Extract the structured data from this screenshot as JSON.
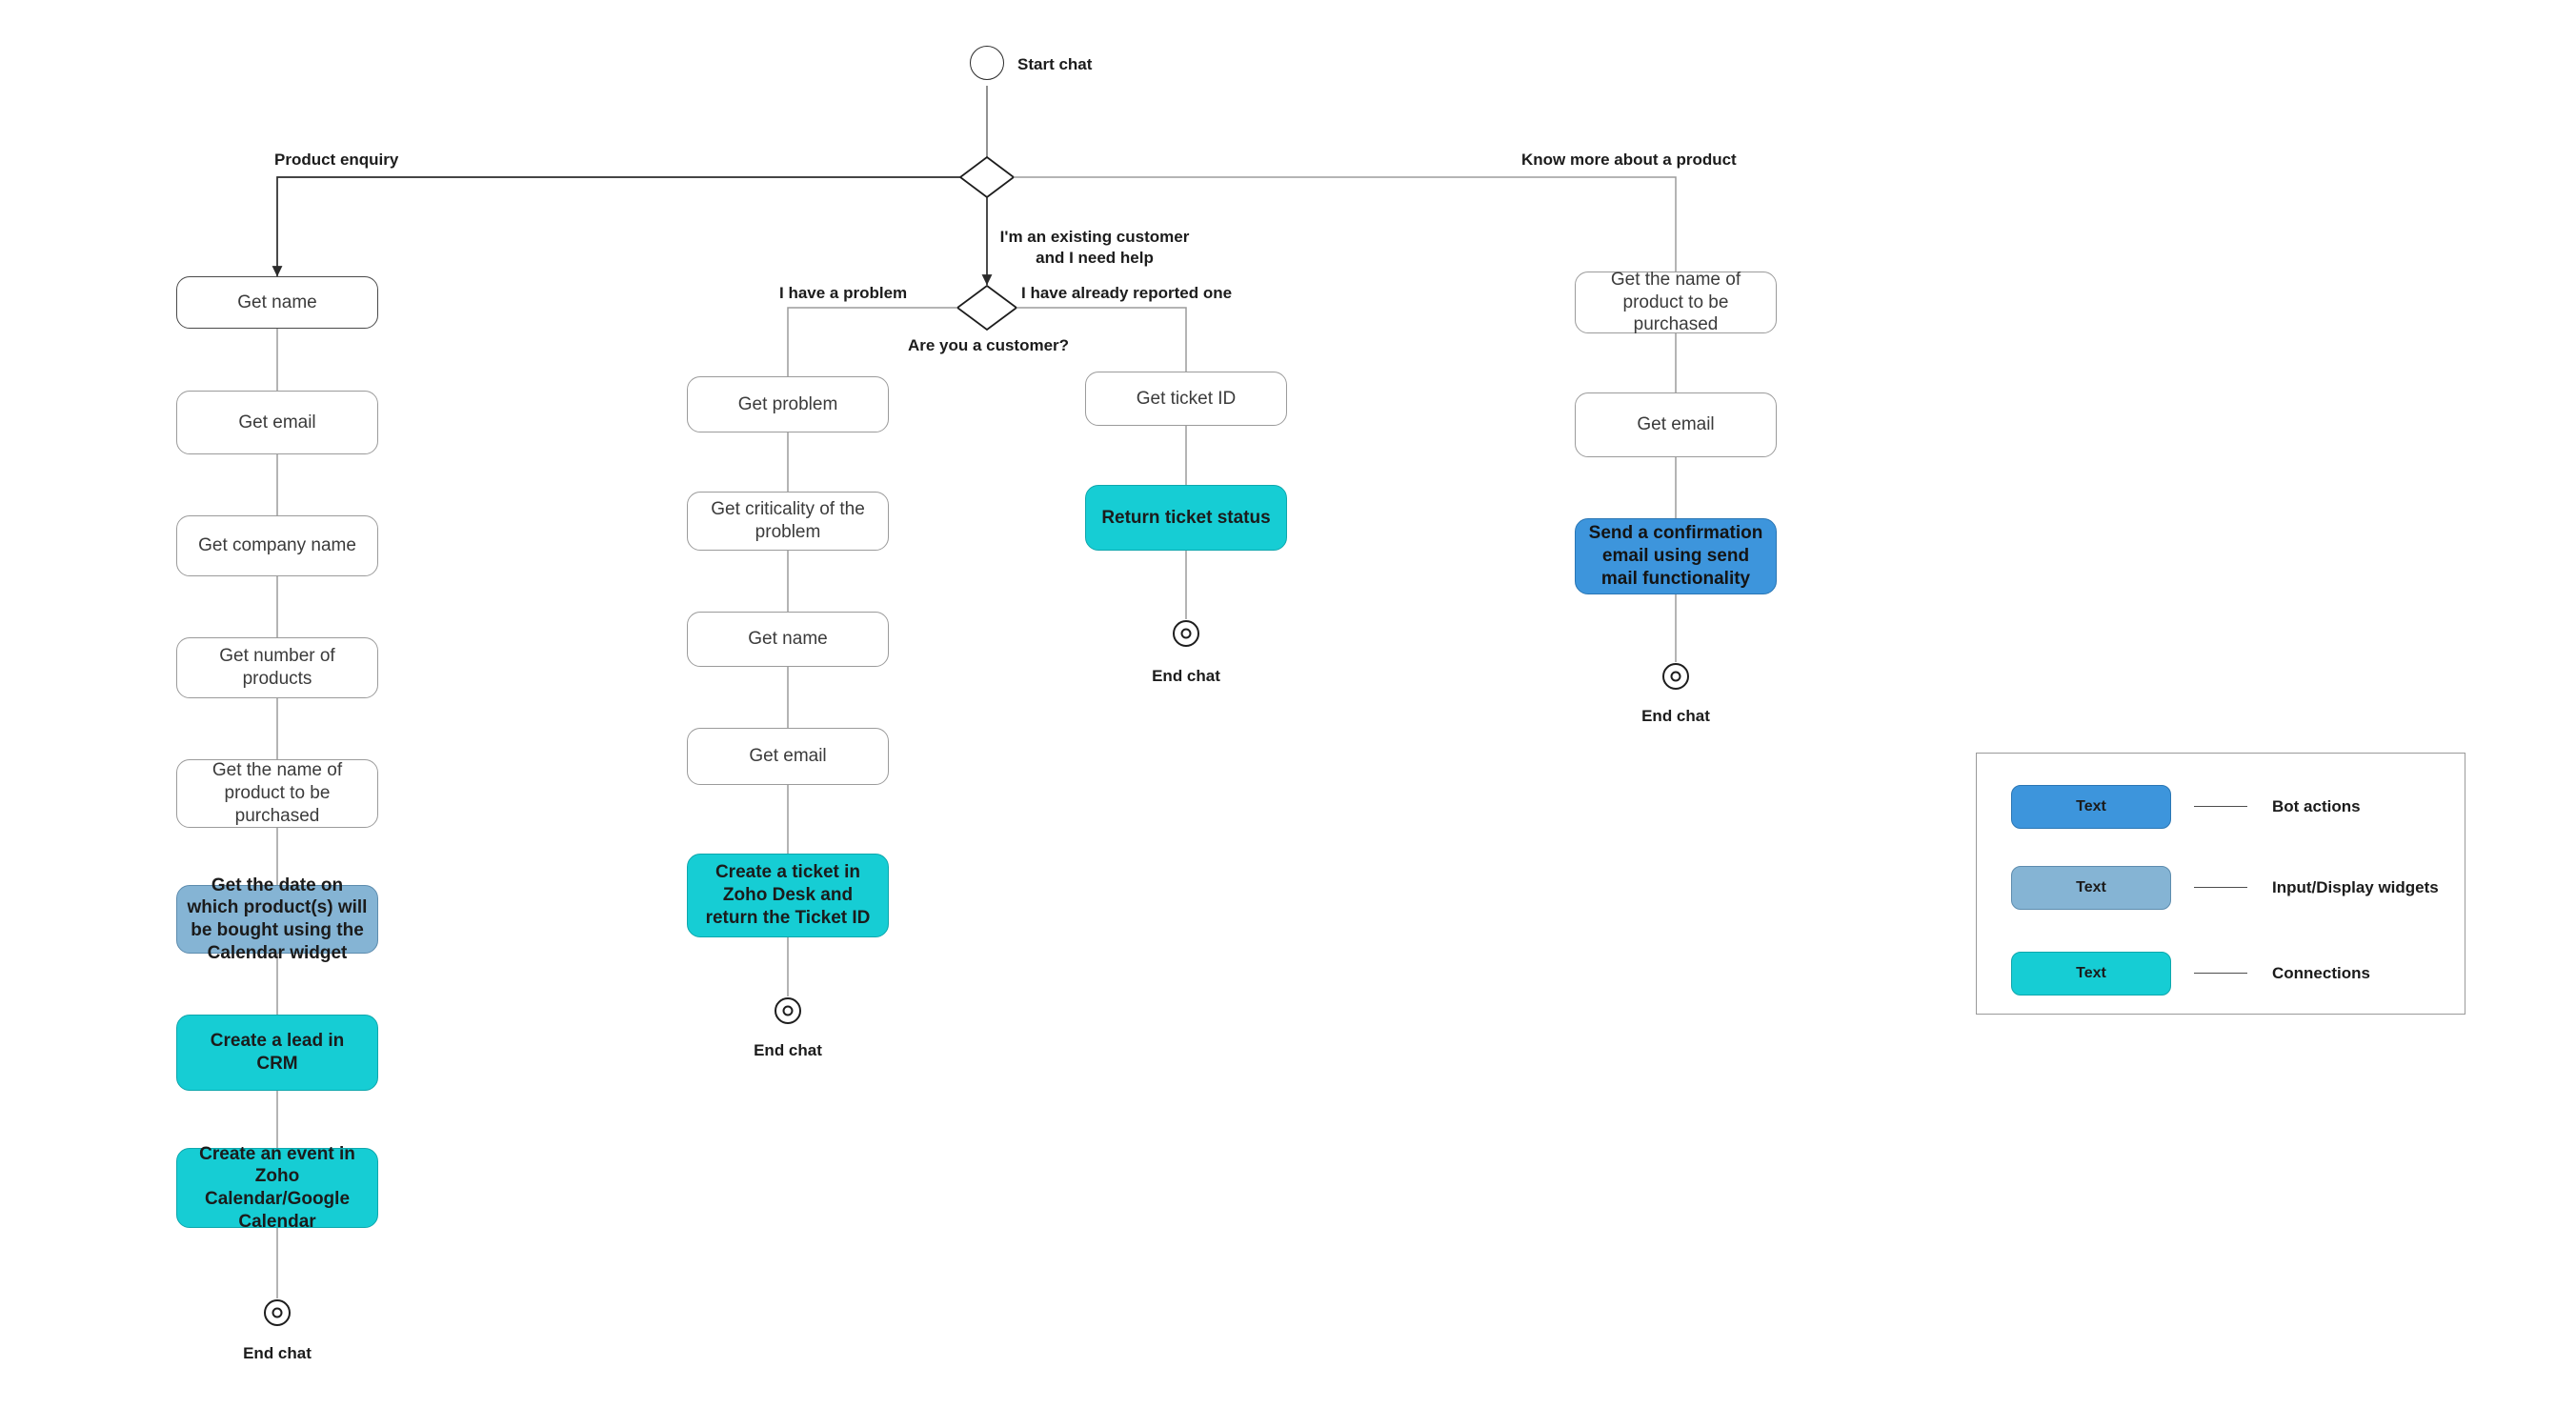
{
  "diagram": {
    "title_present": false,
    "start": {
      "label": "Start chat"
    },
    "decisions": {
      "d1_label": "",
      "d2_label": "Are you a customer?"
    },
    "edge_labels": {
      "product_enquiry": "Product enquiry",
      "existing_customer": "I'm an existing customer and I need help",
      "know_more": "Know more about a product",
      "have_problem": "I have a problem",
      "already_reported": "I have already reported one"
    },
    "branch_left": {
      "nodes": [
        {
          "label": "Get name",
          "kind": "input"
        },
        {
          "label": "Get email",
          "kind": "input"
        },
        {
          "label": "Get  company name",
          "kind": "input"
        },
        {
          "label": "Get  number of products",
          "kind": "input"
        },
        {
          "label": "Get  the name of product to be purchased",
          "kind": "input"
        },
        {
          "label": "Get the date on which product(s) will be bought using the Calendar widget",
          "kind": "widget"
        },
        {
          "label": "Create a lead in CRM",
          "kind": "action"
        },
        {
          "label": "Create an event in Zoho Calendar/Google Calendar",
          "kind": "action"
        }
      ],
      "end_label": "End chat"
    },
    "branch_problem": {
      "nodes": [
        {
          "label": "Get problem",
          "kind": "input"
        },
        {
          "label": "Get  criticality of the problem",
          "kind": "input"
        },
        {
          "label": "Get name",
          "kind": "input"
        },
        {
          "label": "Get email",
          "kind": "input"
        },
        {
          "label": "Create a ticket in Zoho Desk and return the Ticket ID",
          "kind": "action"
        }
      ],
      "end_label": "End chat"
    },
    "branch_ticket": {
      "nodes": [
        {
          "label": "Get ticket ID",
          "kind": "input"
        },
        {
          "label": "Return ticket status",
          "kind": "action"
        }
      ],
      "end_label": "End chat"
    },
    "branch_right": {
      "nodes": [
        {
          "label": "Get  the name of product to be purchased",
          "kind": "input"
        },
        {
          "label": "Get email",
          "kind": "input"
        },
        {
          "label": "Send a confirmation email using send mail functionality",
          "kind": "bot"
        }
      ],
      "end_label": "End chat"
    }
  },
  "legend": {
    "swatch_text": "Text",
    "rows": [
      {
        "label": "Bot actions",
        "color": "#3D95DC"
      },
      {
        "label": "Input/Display widgets",
        "color": "#85B4D4"
      },
      {
        "label": "Connections",
        "color": "#16CDD4"
      }
    ]
  },
  "colors": {
    "action_cyan": "#16CDD4",
    "widget_steel": "#85B4D4",
    "bot_blue": "#3D95DC",
    "stroke_dark": "#2b2b2b",
    "stroke_light": "#9b9b9b",
    "background": "#ffffff"
  }
}
